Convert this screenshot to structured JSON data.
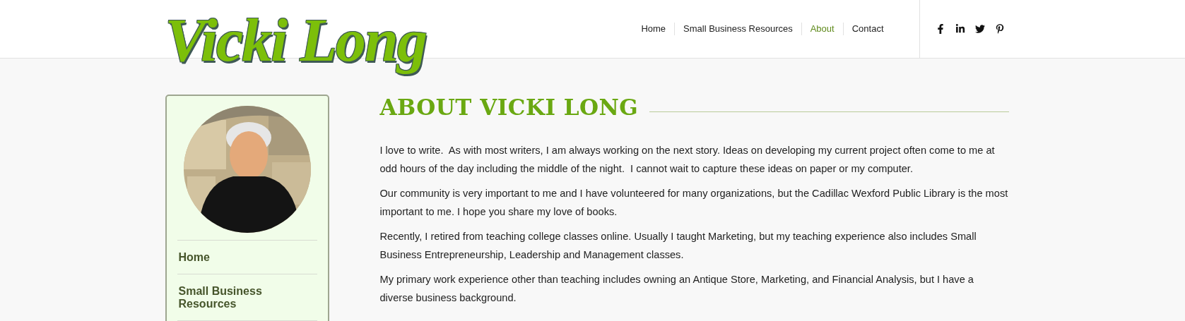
{
  "logo": {
    "text": "Vicki Long"
  },
  "nav": [
    {
      "label": "Home",
      "selected": false
    },
    {
      "label": "Small Business Resources",
      "selected": false
    },
    {
      "label": "About",
      "selected": true
    },
    {
      "label": "Contact",
      "selected": false
    }
  ],
  "social": [
    {
      "kind": "facebook"
    },
    {
      "kind": "linkedin"
    },
    {
      "kind": "twitter"
    },
    {
      "kind": "pinterest"
    }
  ],
  "sidebar": {
    "menu": [
      {
        "label": "Home"
      },
      {
        "label": "Small Business Resources"
      }
    ]
  },
  "content": {
    "title": "ABOUT VICKI LONG",
    "paragraphs": [
      "I love to write.  As with most writers, I am always working on the next story. Ideas on developing my current project often come to me at odd hours of the day including the middle of the night.  I cannot wait to capture these ideas on paper or my computer.",
      "Our community is very important to me and I have volunteered for many organizations, but the Cadillac Wexford Public Library is the most important to me. I hope you share my love of books.",
      "Recently, I retired from teaching college classes online. Usually I taught Marketing, but my teaching experience also includes Small Business Entrepreneurship, Leadership and Management classes.",
      "My primary work experience other than teaching includes owning an Antique Store, Marketing, and Financial Analysis, but I have a diverse business background."
    ]
  }
}
